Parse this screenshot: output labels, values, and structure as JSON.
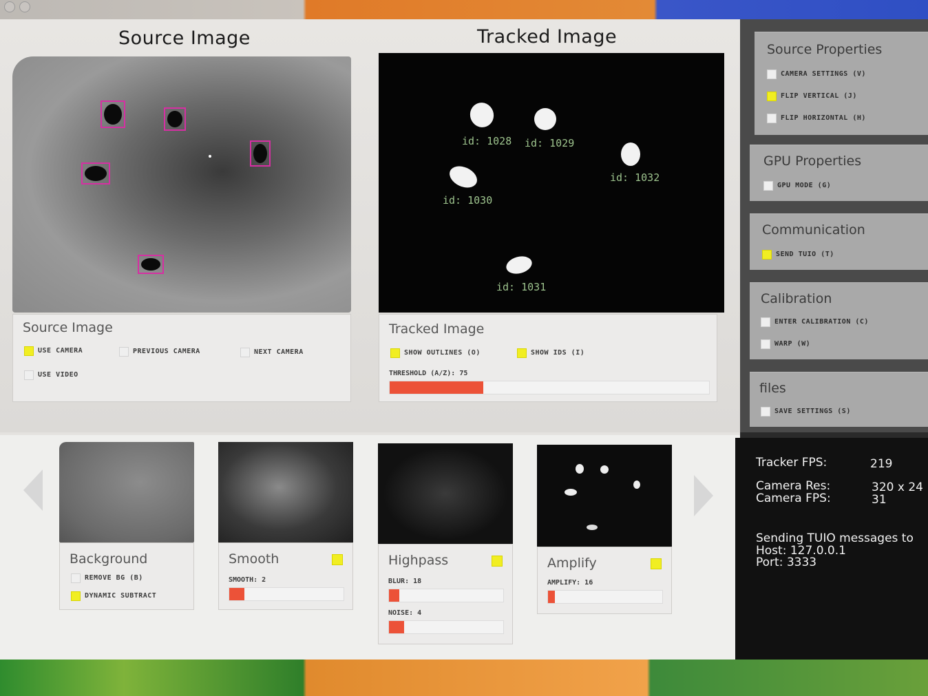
{
  "source_view": {
    "title": "Source Image",
    "panel_title": "Source Image",
    "options": [
      {
        "label": "USE CAMERA",
        "checked": true
      },
      {
        "label": "PREVIOUS CAMERA",
        "checked": false
      },
      {
        "label": "NEXT CAMERA",
        "checked": false
      },
      {
        "label": "USE VIDEO",
        "checked": false
      }
    ]
  },
  "tracked_view": {
    "title": "Tracked Image",
    "panel_title": "Tracked Image",
    "options": [
      {
        "label": "SHOW OUTLINES (O)",
        "checked": true
      },
      {
        "label": "SHOW IDS (I)",
        "checked": true
      }
    ],
    "threshold": {
      "label": "THRESHOLD (A/Z): 75",
      "value": 75,
      "max": 255
    },
    "blob_ids": [
      "id: 1028",
      "id: 1029",
      "id: 1030",
      "id: 1031",
      "id: 1032"
    ]
  },
  "filters": [
    {
      "title": "Background",
      "enabled": null,
      "options": [
        {
          "label": "REMOVE BG (B)",
          "checked": false
        },
        {
          "label": "DYNAMIC SUBTRACT",
          "checked": true
        }
      ]
    },
    {
      "title": "Smooth",
      "enabled": true,
      "sliders": [
        {
          "label": "SMOOTH: 2",
          "value": 2,
          "max": 15
        }
      ]
    },
    {
      "title": "Highpass",
      "enabled": true,
      "sliders": [
        {
          "label": "BLUR: 18",
          "value": 18,
          "max": 200
        },
        {
          "label": "NOISE: 4",
          "value": 4,
          "max": 30
        }
      ]
    },
    {
      "title": "Amplify",
      "enabled": true,
      "sliders": [
        {
          "label": "AMPLIFY: 16",
          "value": 16,
          "max": 300
        }
      ]
    }
  ],
  "sidebar": {
    "source_properties": {
      "title": "Source Properties",
      "options": [
        {
          "label": "CAMERA SETTINGS (V)",
          "checked": false
        },
        {
          "label": "FLIP VERTICAL (J)",
          "checked": true
        },
        {
          "label": "FLIP HORIZONTAL (H)",
          "checked": false
        }
      ]
    },
    "gpu_properties": {
      "title": "GPU Properties",
      "options": [
        {
          "label": "GPU MODE (G)",
          "checked": false
        }
      ]
    },
    "communication": {
      "title": "Communication",
      "options": [
        {
          "label": "SEND TUIO (T)",
          "checked": true
        }
      ]
    },
    "calibration": {
      "title": "Calibration",
      "options": [
        {
          "label": "ENTER CALIBRATION (C)",
          "checked": false
        },
        {
          "label": "WARP (W)",
          "checked": false
        }
      ]
    },
    "files": {
      "title": "files",
      "options": [
        {
          "label": "SAVE SETTINGS (S)",
          "checked": false
        }
      ]
    }
  },
  "stats": {
    "tracker_fps_label": "Tracker FPS:",
    "tracker_fps": "219",
    "camera_res_label": "Camera Res:",
    "camera_res": "320 x 24",
    "camera_fps_label": "Camera FPS:",
    "camera_fps": "31",
    "sending_label": "Sending TUIO messages to",
    "host_label": "Host: 127.0.0.1",
    "port_label": "Port: 3333"
  },
  "colors": {
    "accent_check": "#f1ee22",
    "slider_fill": "#ec5238",
    "marker": "#d62fa3",
    "id_text": "#9ec48e"
  }
}
